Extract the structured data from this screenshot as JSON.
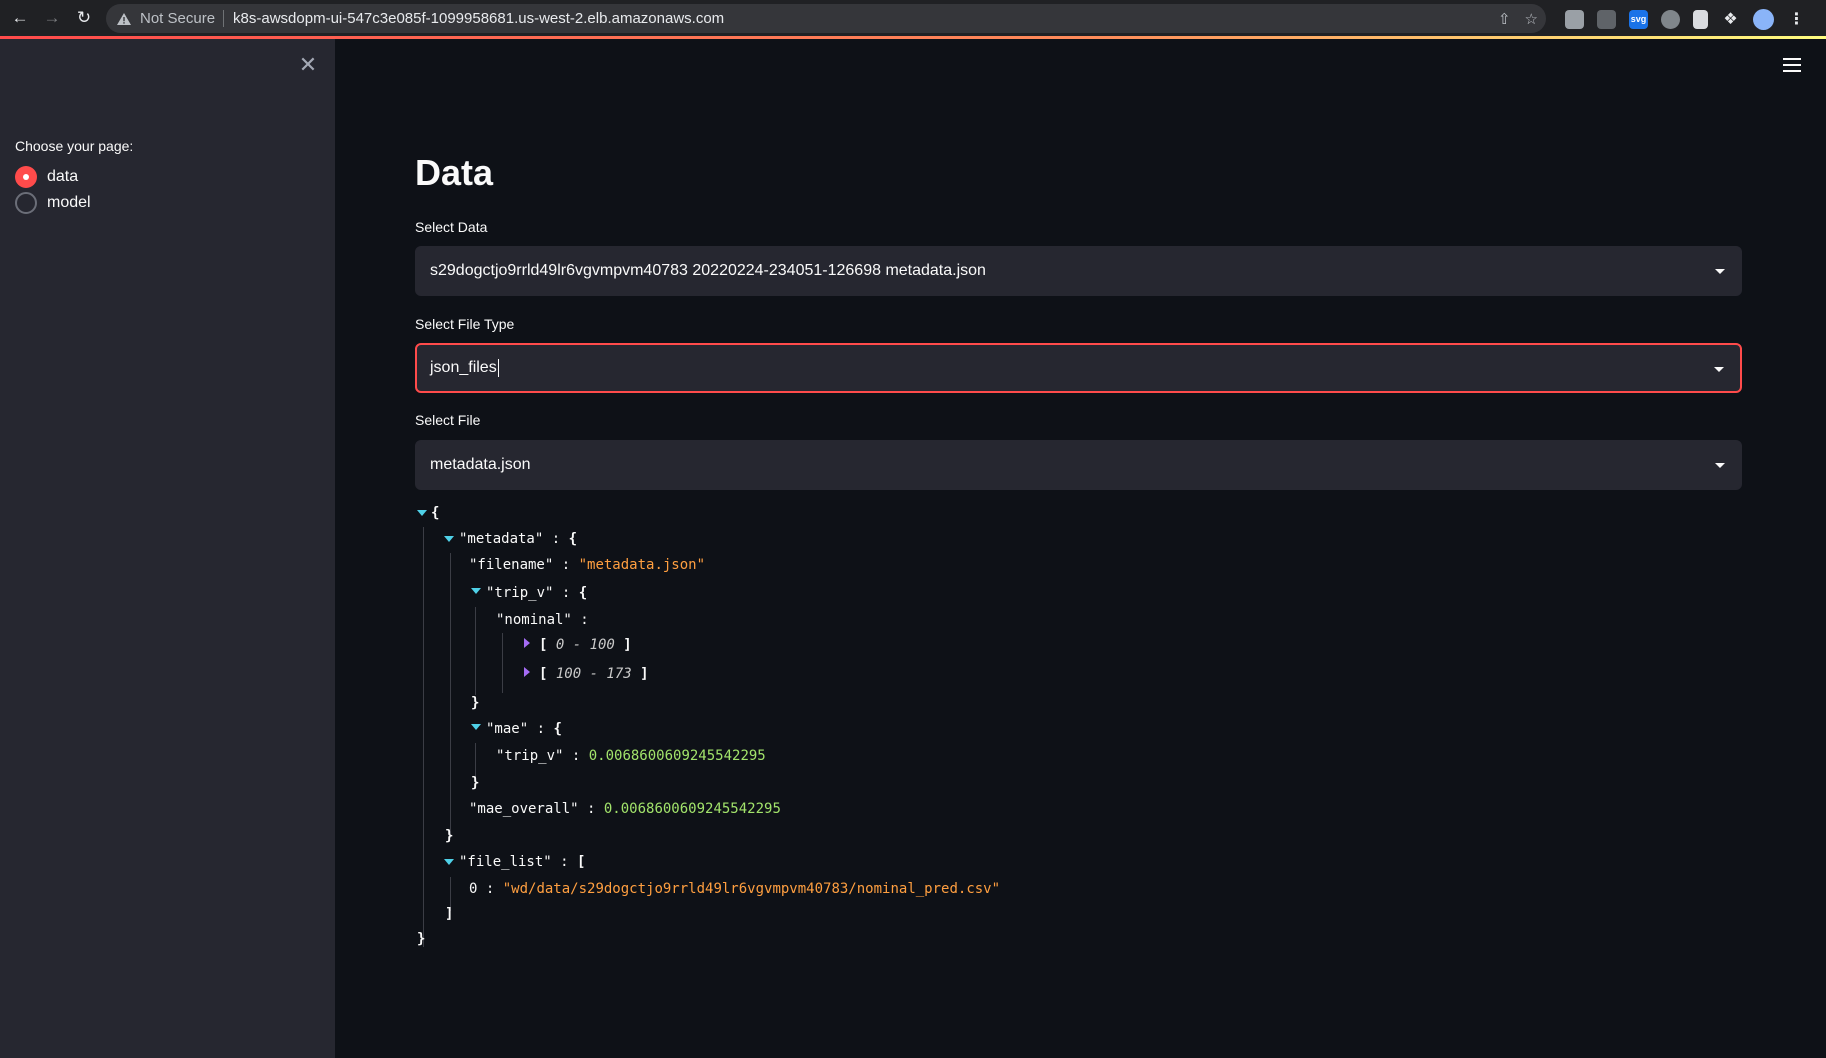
{
  "browser": {
    "security_label": "Not Secure",
    "url": "k8s-awsdopm-ui-547c3e085f-1099958681.us-west-2.elb.amazonaws.com",
    "extensions": [
      "cast-icon",
      "ext-tile-icon",
      "svg-ext-icon",
      "ext-gear-icon",
      "ext-doc-icon",
      "puzzle-icon",
      "profile-avatar",
      "kebab-menu-icon"
    ]
  },
  "sidebar": {
    "label": "Choose your page:",
    "options": [
      {
        "label": "data",
        "selected": true
      },
      {
        "label": "model",
        "selected": false
      }
    ]
  },
  "main": {
    "title": "Data",
    "select_data": {
      "label": "Select Data",
      "value": "s29dogctjo9rrld49lr6vgvmpvm40783 20220224-234051-126698 metadata.json"
    },
    "select_file_type": {
      "label": "Select File Type",
      "value": "json_files"
    },
    "select_file": {
      "label": "Select File",
      "value": "metadata.json"
    }
  },
  "json_view": {
    "open_brace": "{",
    "close_brace": "}",
    "metadata_key": "\"metadata\"",
    "filename_key": "\"filename\"",
    "filename_value": "\"metadata.json\"",
    "trip_v_key": "\"trip_v\"",
    "nominal_key": "\"nominal\"",
    "range1": "0 - 100",
    "range2": "100 - 173",
    "mae_key": "\"mae\"",
    "mae_trip_v_key": "\"trip_v\"",
    "mae_trip_v_value": "0.0068600609245542295",
    "mae_overall_key": "\"mae_overall\"",
    "mae_overall_value": "0.0068600609245542295",
    "file_list_key": "\"file_list\"",
    "file_list_index": "0",
    "file_list_value": "\"wd/data/s29dogctjo9rrld49lr6vgvmpvm40783/nominal_pred.csv\""
  },
  "colors": {
    "accent": "#ff4b4b",
    "string": "#ff9f40",
    "number": "#a2e36b",
    "collapse_open": "#4fd1e8",
    "collapse_closed": "#a56cf5"
  }
}
